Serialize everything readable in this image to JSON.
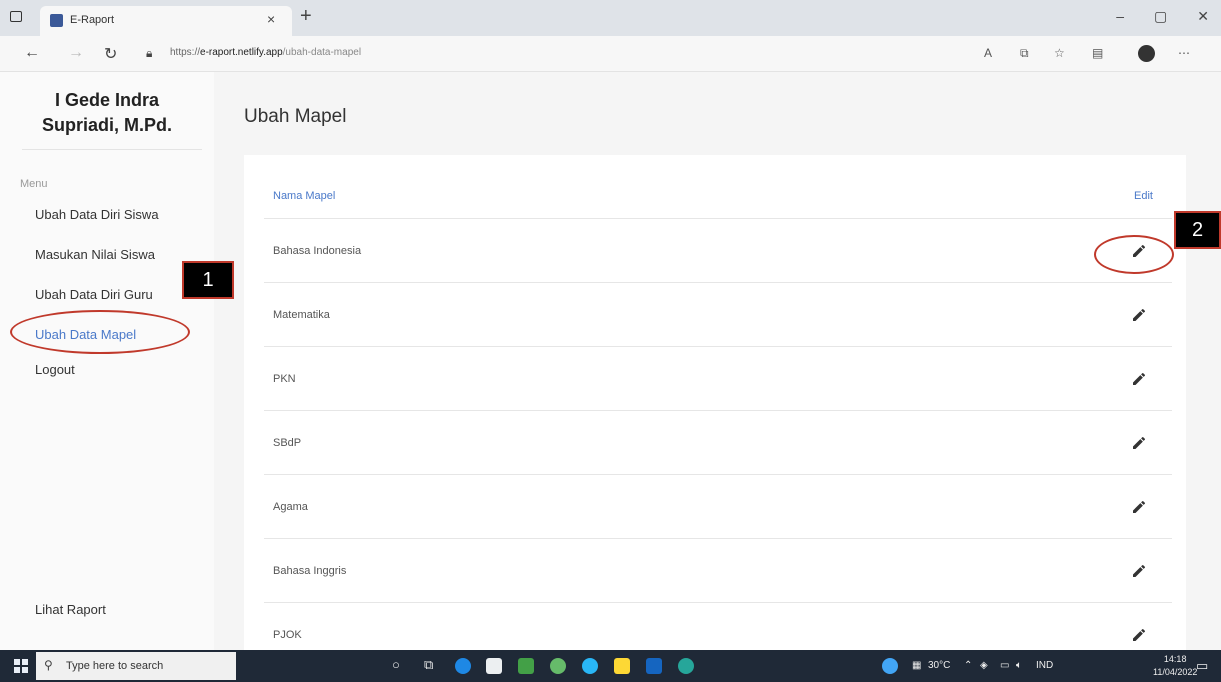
{
  "browser": {
    "tab_title": "E-Raport",
    "tab_close": "×",
    "new_tab": "+",
    "url_scheme": "https://",
    "url_host": "e-raport.netlify.app",
    "url_path": "/ubah-data-mapel",
    "window_controls": [
      "–",
      "▢",
      "✕"
    ]
  },
  "sidebar": {
    "user_name_line1": "I Gede Indra",
    "user_name_line2": "Supriadi, M.Pd.",
    "menu_label": "Menu",
    "items": [
      {
        "label": "Ubah Data Diri Siswa"
      },
      {
        "label": "Masukan Nilai Siswa"
      },
      {
        "label": "Ubah Data Diri Guru"
      },
      {
        "label": "Ubah Data Mapel"
      },
      {
        "label": "Logout"
      }
    ],
    "footer_link": "Lihat Raport"
  },
  "main": {
    "title": "Ubah Mapel",
    "table": {
      "header_name": "Nama Mapel",
      "header_edit": "Edit",
      "rows": [
        {
          "name": "Bahasa Indonesia"
        },
        {
          "name": "Matematika"
        },
        {
          "name": "PKN"
        },
        {
          "name": "SBdP"
        },
        {
          "name": "Agama"
        },
        {
          "name": "Bahasa Inggris"
        },
        {
          "name": "PJOK"
        }
      ]
    }
  },
  "annotations": {
    "label_1": "1",
    "label_2": "2"
  },
  "taskbar": {
    "search_placeholder": "Type here to search",
    "temperature": "30°C",
    "language": "IND",
    "time": "14:18",
    "date": "11/04/2022"
  },
  "colors": {
    "accent": "#4a79c9",
    "annotation": "#c0392b"
  }
}
